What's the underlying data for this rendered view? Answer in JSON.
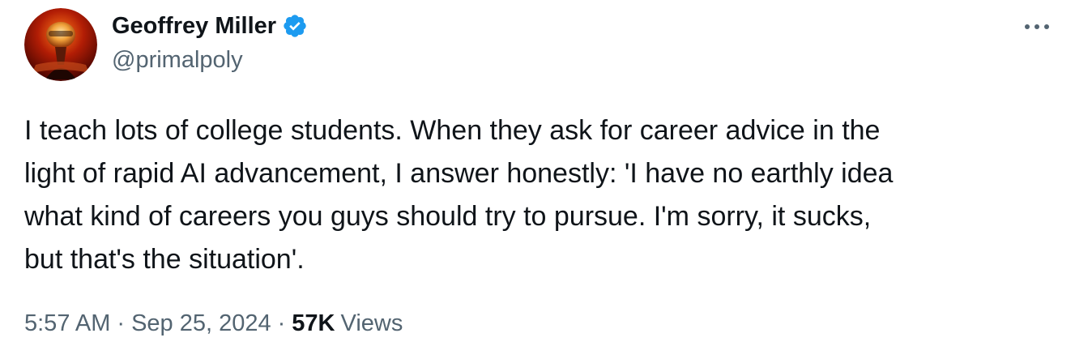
{
  "author": {
    "display_name": "Geoffrey Miller",
    "handle": "@primalpoly",
    "verified": true,
    "avatar_icon": "avatar-portrait"
  },
  "more_icon": "ellipsis-icon",
  "tweet": {
    "text_lines": [
      "I teach lots of college students. When they ask for career advice in the",
      "light of rapid AI advancement, I answer honestly: 'I have no earthly idea",
      "what kind of careers you guys should try to pursue. I'm sorry, it sucks,",
      "but that's the situation'."
    ]
  },
  "meta": {
    "time": "5:57 AM",
    "separator": "·",
    "date": "Sep 25, 2024",
    "views_count": "57K",
    "views_label": "Views"
  },
  "colors": {
    "text_primary": "#0f1419",
    "text_secondary": "#536471",
    "verified_blue": "#1d9bf0"
  }
}
